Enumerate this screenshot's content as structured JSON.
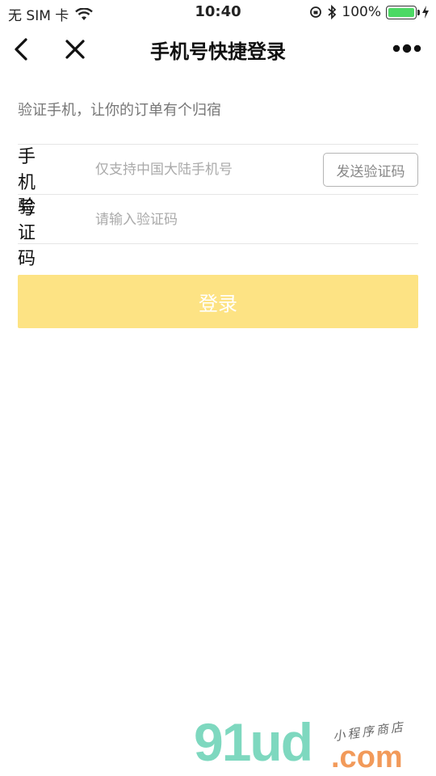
{
  "status_bar": {
    "carrier": "无 SIM 卡",
    "time": "10:40",
    "battery_percent": "100%",
    "battery_level": 1.0
  },
  "nav": {
    "title": "手机号快捷登录",
    "back_icon": "chevron-left-icon",
    "close_icon": "close-icon",
    "more_icon": "more-dots-icon"
  },
  "subtitle": "验证手机，让你的订单有个归宿",
  "form": {
    "phone_label": "手机号",
    "phone_placeholder": "仅支持中国大陆手机号",
    "phone_value": "",
    "send_code_label": "发送验证码",
    "code_label": "验证码",
    "code_placeholder": "请输入验证码",
    "code_value": ""
  },
  "login_label": "登录",
  "colors": {
    "login_bg": "#fde384",
    "watermark_green": "#7ed8bf",
    "watermark_orange": "#f29a5a"
  },
  "watermark": {
    "brand": "91ud",
    "suffix": ".com",
    "tagline": "小程序商店"
  }
}
